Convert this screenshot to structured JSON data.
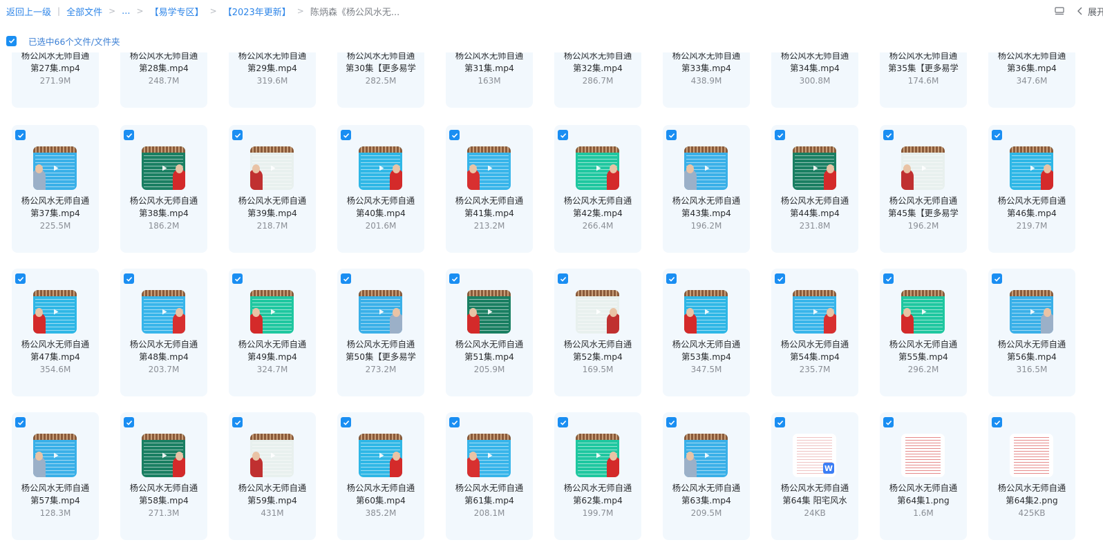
{
  "breadcrumb": {
    "back": "返回上一级",
    "all_files": "全部文件",
    "ellipsis": "...",
    "folder1": "【易学专区】",
    "folder2": "【2023年更新】",
    "current": "陈炳森《杨公风水无..."
  },
  "toolbar": {
    "expand": "展开",
    "view_icon": "list-view-icon",
    "chevron_icon": "chevron-left-icon"
  },
  "selection": {
    "label": "已选中66个文件/文件夹"
  },
  "colors": {
    "accent": "#1a8ef2",
    "tile_bg": "#f2f8fd",
    "link": "#2f86e8"
  },
  "rows": [
    [
      {
        "l1": "杨公风水无师自通",
        "l2": "第27集.mp4",
        "size": "271.9M"
      },
      {
        "l1": "杨公风水无师自通",
        "l2": "第28集.mp4",
        "size": "248.7M"
      },
      {
        "l1": "杨公风水无师自通",
        "l2": "第29集.mp4",
        "size": "319.6M"
      },
      {
        "l1": "杨公风水无师自通",
        "l2": "第30集【更多易学",
        "size": "282.5M"
      },
      {
        "l1": "杨公风水无师自通",
        "l2": "第31集.mp4",
        "size": "163M"
      },
      {
        "l1": "杨公风水无师自通",
        "l2": "第32集.mp4",
        "size": "286.7M"
      },
      {
        "l1": "杨公风水无师自通",
        "l2": "第33集.mp4",
        "size": "438.9M"
      },
      {
        "l1": "杨公风水无师自通",
        "l2": "第34集.mp4",
        "size": "300.8M"
      },
      {
        "l1": "杨公风水无师自通",
        "l2": "第35集【更多易学",
        "size": "174.6M"
      },
      {
        "l1": "杨公风水无师自通",
        "l2": "第36集.mp4",
        "size": "347.6M"
      }
    ],
    [
      {
        "l1": "杨公风水无师自通",
        "l2": "第37集.mp4",
        "size": "225.5M"
      },
      {
        "l1": "杨公风水无师自通",
        "l2": "第38集.mp4",
        "size": "186.2M"
      },
      {
        "l1": "杨公风水无师自通",
        "l2": "第39集.mp4",
        "size": "218.7M"
      },
      {
        "l1": "杨公风水无师自通",
        "l2": "第40集.mp4",
        "size": "201.6M"
      },
      {
        "l1": "杨公风水无师自通",
        "l2": "第41集.mp4",
        "size": "213.2M"
      },
      {
        "l1": "杨公风水无师自通",
        "l2": "第42集.mp4",
        "size": "266.4M"
      },
      {
        "l1": "杨公风水无师自通",
        "l2": "第43集.mp4",
        "size": "196.2M"
      },
      {
        "l1": "杨公风水无师自通",
        "l2": "第44集.mp4",
        "size": "231.8M"
      },
      {
        "l1": "杨公风水无师自通",
        "l2": "第45集【更多易学",
        "size": "196.2M"
      },
      {
        "l1": "杨公风水无师自通",
        "l2": "第46集.mp4",
        "size": "219.7M"
      }
    ],
    [
      {
        "l1": "杨公风水无师自通",
        "l2": "第47集.mp4",
        "size": "354.6M"
      },
      {
        "l1": "杨公风水无师自通",
        "l2": "第48集.mp4",
        "size": "203.7M"
      },
      {
        "l1": "杨公风水无师自通",
        "l2": "第49集.mp4",
        "size": "324.7M"
      },
      {
        "l1": "杨公风水无师自通",
        "l2": "第50集【更多易学",
        "size": "273.2M"
      },
      {
        "l1": "杨公风水无师自通",
        "l2": "第51集.mp4",
        "size": "205.9M"
      },
      {
        "l1": "杨公风水无师自通",
        "l2": "第52集.mp4",
        "size": "169.5M"
      },
      {
        "l1": "杨公风水无师自通",
        "l2": "第53集.mp4",
        "size": "347.5M"
      },
      {
        "l1": "杨公风水无师自通",
        "l2": "第54集.mp4",
        "size": "235.7M"
      },
      {
        "l1": "杨公风水无师自通",
        "l2": "第55集.mp4",
        "size": "296.2M"
      },
      {
        "l1": "杨公风水无师自通",
        "l2": "第56集.mp4",
        "size": "316.5M"
      }
    ],
    [
      {
        "l1": "杨公风水无师自通",
        "l2": "第57集.mp4",
        "size": "128.3M"
      },
      {
        "l1": "杨公风水无师自通",
        "l2": "第58集.mp4",
        "size": "271.3M"
      },
      {
        "l1": "杨公风水无师自通",
        "l2": "第59集.mp4",
        "size": "431M"
      },
      {
        "l1": "杨公风水无师自通",
        "l2": "第60集.mp4",
        "size": "385.2M"
      },
      {
        "l1": "杨公风水无师自通",
        "l2": "第61集.mp4",
        "size": "208.1M"
      },
      {
        "l1": "杨公风水无师自通",
        "l2": "第62集.mp4",
        "size": "199.7M"
      },
      {
        "l1": "杨公风水无师自通",
        "l2": "第63集.mp4",
        "size": "209.5M"
      },
      {
        "l1": "杨公风水无师自通",
        "l2": "第64集 阳宅风水",
        "size": "24KB",
        "kind": "doc"
      },
      {
        "l1": "杨公风水无师自通",
        "l2": "第64集1.png",
        "size": "1.6M",
        "kind": "image"
      },
      {
        "l1": "杨公风水无师自通",
        "l2": "第64集2.png",
        "size": "425KB",
        "kind": "image"
      }
    ]
  ]
}
